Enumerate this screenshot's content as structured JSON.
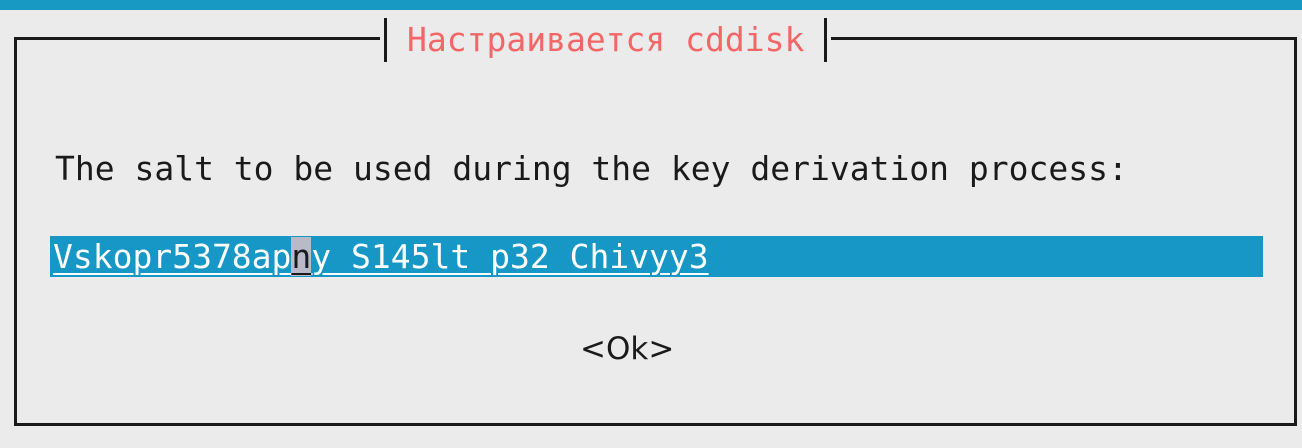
{
  "dialog": {
    "title": "Настраивается cddisk",
    "prompt": "The salt to be used during the key derivation process:",
    "input": {
      "value_before_cursor": "Vskopr5378ap",
      "value_at_cursor": "n",
      "value_after_cursor": "y S145lt p32 Chivyy3"
    },
    "ok_label": "<Ok>"
  },
  "colors": {
    "title": "#f26666",
    "input_background": "#1697c5",
    "top_stripe": "#1799c4",
    "background": "#ebebeb"
  }
}
